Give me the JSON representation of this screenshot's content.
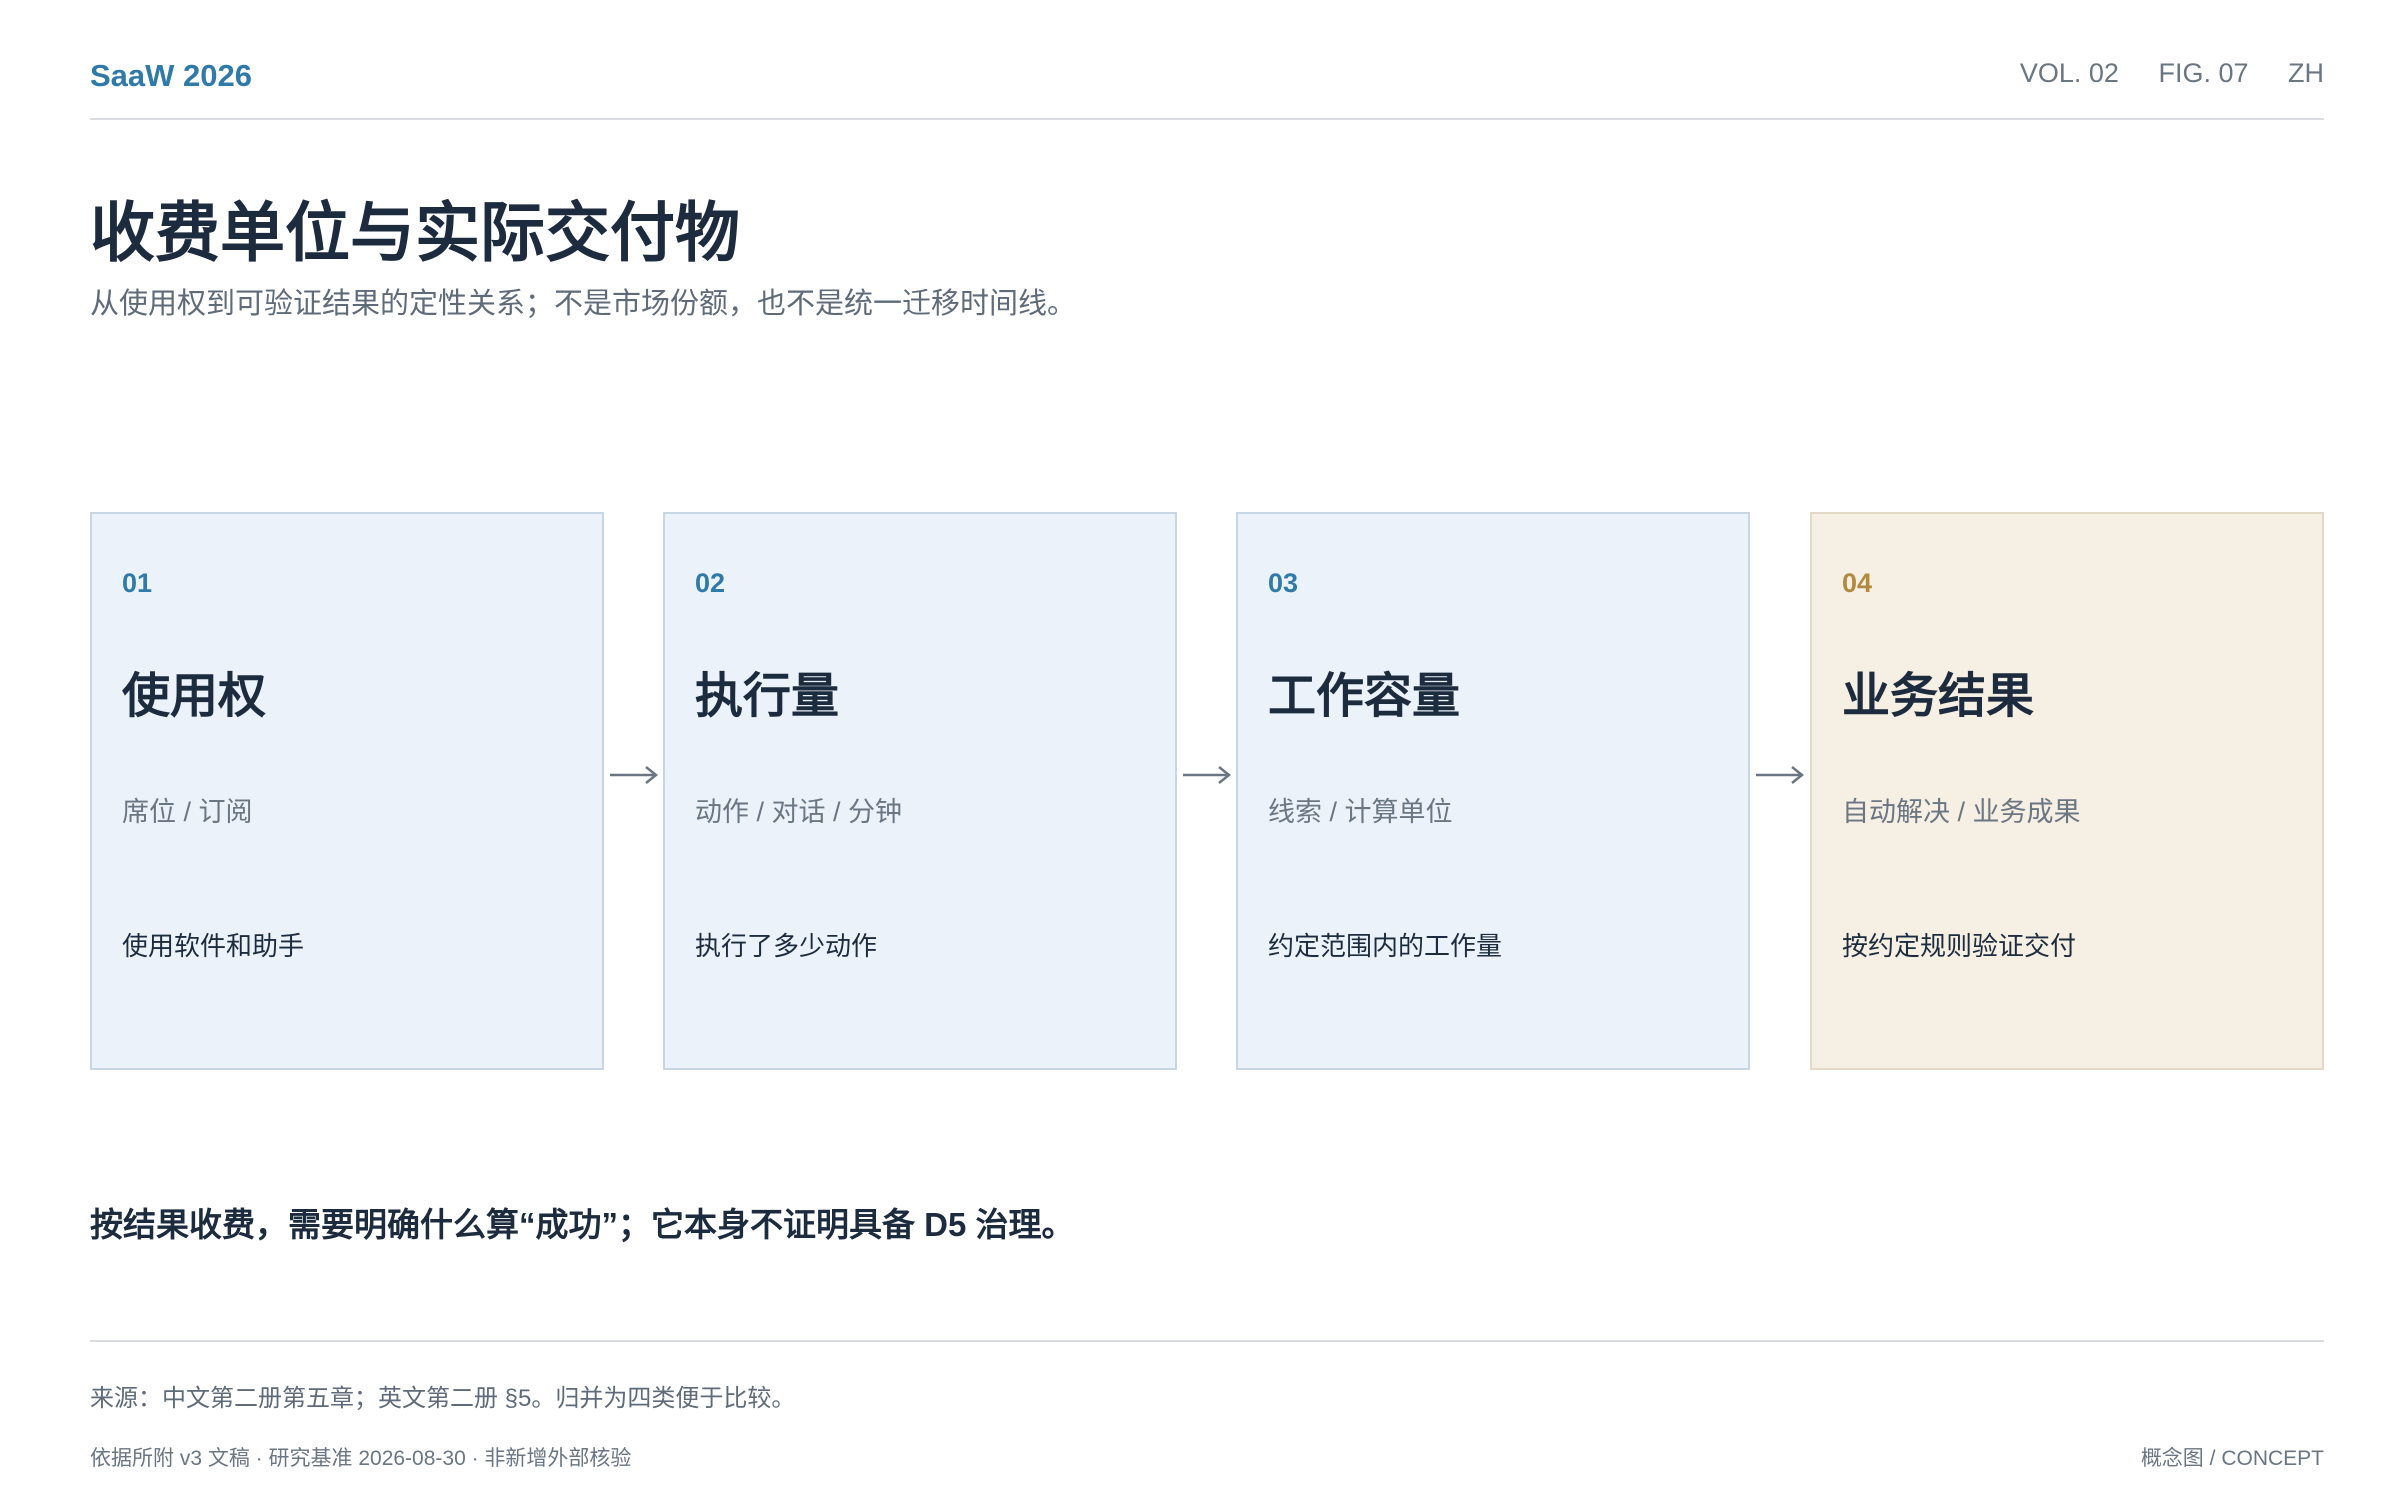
{
  "header": {
    "brand": "SaaW 2026",
    "volume": "VOL. 02",
    "figure": "FIG. 07",
    "language": "ZH"
  },
  "title": "收费单位与实际交付物",
  "subtitle": "从使用权到可验证结果的定性关系；不是市场份额，也不是统一迁移时间线。",
  "cards": [
    {
      "number": "01",
      "title": "使用权",
      "subtitle": "席位 / 订阅",
      "description": "使用软件和助手"
    },
    {
      "number": "02",
      "title": "执行量",
      "subtitle": "动作 / 对话 / 分钟",
      "description": "执行了多少动作"
    },
    {
      "number": "03",
      "title": "工作容量",
      "subtitle": "线索 / 计算单位",
      "description": "约定范围内的工作量"
    },
    {
      "number": "04",
      "title": "业务结果",
      "subtitle": "自动解决 / 业务成果",
      "description": "按约定规则验证交付"
    }
  ],
  "note": "按结果收费，需要明确什么算“成功”；它本身不证明具备 D5 治理。",
  "source": "来源：中文第二册第五章；英文第二册 §5。归并为四类便于比较。",
  "footer": {
    "left": "依据所附 v3 文稿 · 研究基准 2026-08-30 · 非新增外部核验",
    "right": "概念图 / CONCEPT"
  },
  "colors": {
    "accent": "#2f7aa8",
    "highlight_accent": "#b08a3e",
    "card_bg": "#ebf2f9",
    "highlight_bg": "#f6efe3",
    "text_dark": "#1c2b3e",
    "text_muted": "#6b7683"
  }
}
